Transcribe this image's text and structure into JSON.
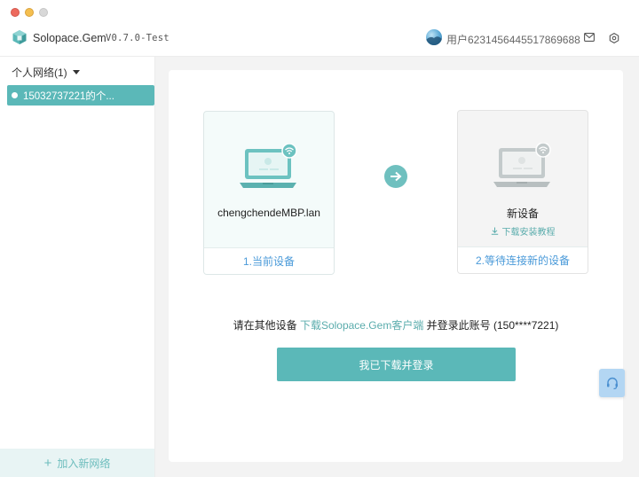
{
  "titlebar": {
    "app_name": "Solopace.Gem",
    "version": "V0.7.0-Test",
    "user_label": "用户6231456445517869688"
  },
  "sidebar": {
    "network_header": "个人网络(1)",
    "networks": [
      {
        "label": "15032737221的个..."
      }
    ],
    "add_network_label": "加入新网络"
  },
  "main": {
    "current_device": {
      "name": "chengchendeMBP.lan",
      "step_label": "1.当前设备"
    },
    "new_device": {
      "name": "新设备",
      "tutorial_link": "下载安装教程",
      "step_label": "2.等待连接新的设备"
    },
    "instruction": {
      "prefix": "请在其他设备 ",
      "link": "下载Solopace.Gem客户端",
      "suffix": " 并登录此账号 (150****7221)"
    },
    "primary_button": "我已下载并登录"
  },
  "colors": {
    "accent": "#5bb8b8",
    "link_blue": "#4a9ad9"
  },
  "icons": [
    "app-logo-icon",
    "avatar",
    "mail-icon",
    "gear-icon",
    "caret-down-icon",
    "plus-icon",
    "laptop-icon",
    "wifi-icon",
    "arrow-right-icon",
    "download-icon",
    "headset-icon"
  ]
}
